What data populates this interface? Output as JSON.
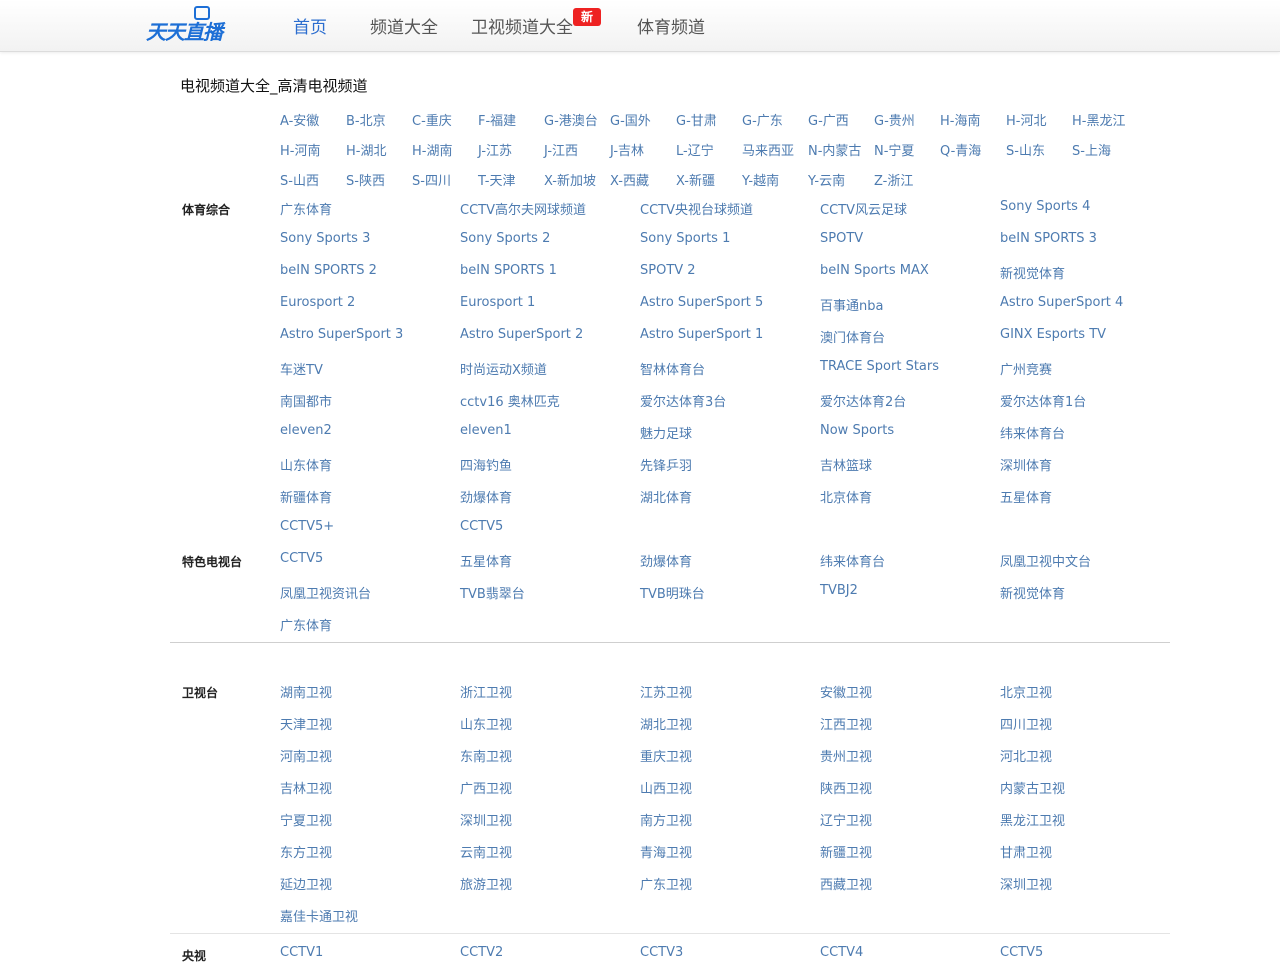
{
  "header": {
    "logo_text": "天天直播",
    "nav": [
      "首页",
      "频道大全",
      "卫视频道大全",
      "体育频道"
    ],
    "new_badge": "新"
  },
  "page_title": "电视频道大全_高清电视频道",
  "letters": [
    [
      "A-安徽",
      "B-北京",
      "C-重庆",
      "F-福建",
      "G-港澳台",
      "G-国外",
      "G-甘肃",
      "G-广东",
      "G-广西",
      "G-贵州",
      "H-海南",
      "H-河北",
      "H-黑龙江"
    ],
    [
      "H-河南",
      "H-湖北",
      "H-湖南",
      "J-江苏",
      "J-江西",
      "J-吉林",
      "L-辽宁",
      "马来西亚",
      "N-内蒙古",
      "N-宁夏",
      "Q-青海",
      "S-山东",
      "S-上海"
    ],
    [
      "S-山西",
      "S-陕西",
      "S-四川",
      "T-天津",
      "X-新加坡",
      "X-西藏",
      "X-新疆",
      "Y-越南",
      "Y-云南",
      "Z-浙江"
    ]
  ],
  "sections": [
    {
      "name": "体育综合",
      "items": [
        "广东体育",
        "CCTV高尔夫网球频道",
        "CCTV央视台球频道",
        "CCTV风云足球",
        "Sony Sports 4",
        "Sony Sports 3",
        "Sony Sports 2",
        "Sony Sports 1",
        "SPOTV",
        "beIN SPORTS 3",
        "beIN SPORTS 2",
        "beIN SPORTS 1",
        "SPOTV 2",
        "beIN Sports MAX",
        "新视觉体育",
        "Eurosport 2",
        "Eurosport 1",
        "Astro SuperSport 5",
        "百事通nba",
        "Astro SuperSport 4",
        "Astro SuperSport 3",
        "Astro SuperSport 2",
        "Astro SuperSport 1",
        "澳门体育台",
        "GINX Esports TV",
        "车迷TV",
        "时尚运动X频道",
        "智林体育台",
        "TRACE Sport Stars",
        "广州竞赛",
        "南国都市",
        "cctv16 奥林匹克",
        "爱尔达体育3台",
        "爱尔达体育2台",
        "爱尔达体育1台",
        "eleven2",
        "eleven1",
        "魅力足球",
        "Now Sports",
        "纬来体育台",
        "山东体育",
        "四海钓鱼",
        "先锋乒羽",
        "吉林篮球",
        "深圳体育",
        "新疆体育",
        "劲爆体育",
        "湖北体育",
        "北京体育",
        "五星体育",
        "CCTV5+",
        "CCTV5"
      ]
    },
    {
      "name": "特色电视台",
      "items": [
        "CCTV5",
        "五星体育",
        "劲爆体育",
        "纬来体育台",
        "凤凰卫视中文台",
        "凤凰卫视资讯台",
        "TVB翡翠台",
        "TVB明珠台",
        "TVBJ2",
        "新视觉体育",
        "广东体育"
      ]
    },
    {
      "name": "卫视台",
      "items": [
        "湖南卫视",
        "浙江卫视",
        "江苏卫视",
        "安徽卫视",
        "北京卫视",
        "天津卫视",
        "山东卫视",
        "湖北卫视",
        "江西卫视",
        "四川卫视",
        "河南卫视",
        "东南卫视",
        "重庆卫视",
        "贵州卫视",
        "河北卫视",
        "吉林卫视",
        "广西卫视",
        "山西卫视",
        "陕西卫视",
        "内蒙古卫视",
        "宁夏卫视",
        "深圳卫视",
        "南方卫视",
        "辽宁卫视",
        "黑龙江卫视",
        "东方卫视",
        "云南卫视",
        "青海卫视",
        "新疆卫视",
        "甘肃卫视",
        "延边卫视",
        "旅游卫视",
        "广东卫视",
        "西藏卫视",
        "深圳卫视",
        "嘉佳卡通卫视"
      ]
    },
    {
      "name": "央视",
      "items": [
        "CCTV1",
        "CCTV2",
        "CCTV3",
        "CCTV4",
        "CCTV5"
      ]
    }
  ]
}
